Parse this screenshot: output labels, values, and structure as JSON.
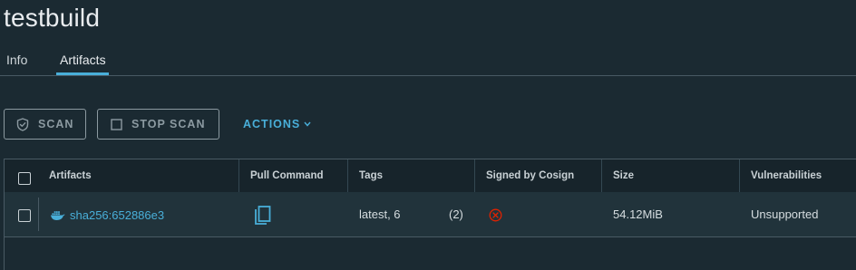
{
  "page": {
    "title": "testbuild"
  },
  "tabs": [
    {
      "label": "Info",
      "active": false
    },
    {
      "label": "Artifacts",
      "active": true
    }
  ],
  "toolbar": {
    "scan_label": "SCAN",
    "stop_scan_label": "STOP SCAN",
    "actions_label": "ACTIONS"
  },
  "table": {
    "columns": [
      "Artifacts",
      "Pull Command",
      "Tags",
      "Signed by Cosign",
      "Size",
      "Vulnerabilities"
    ],
    "rows": [
      {
        "artifact": "sha256:652886e3",
        "artifact_icon": "docker-icon",
        "pull_command_icon": "copy-icon",
        "tags": "latest, 6",
        "tags_count": "(2)",
        "signed_icon": "not-signed-x-icon",
        "size": "54.12MiB",
        "vulnerabilities": "Unsupported"
      }
    ]
  },
  "colors": {
    "background": "#1b2a32",
    "accent": "#49afd9",
    "danger": "#e12200",
    "border": "#495a64"
  }
}
